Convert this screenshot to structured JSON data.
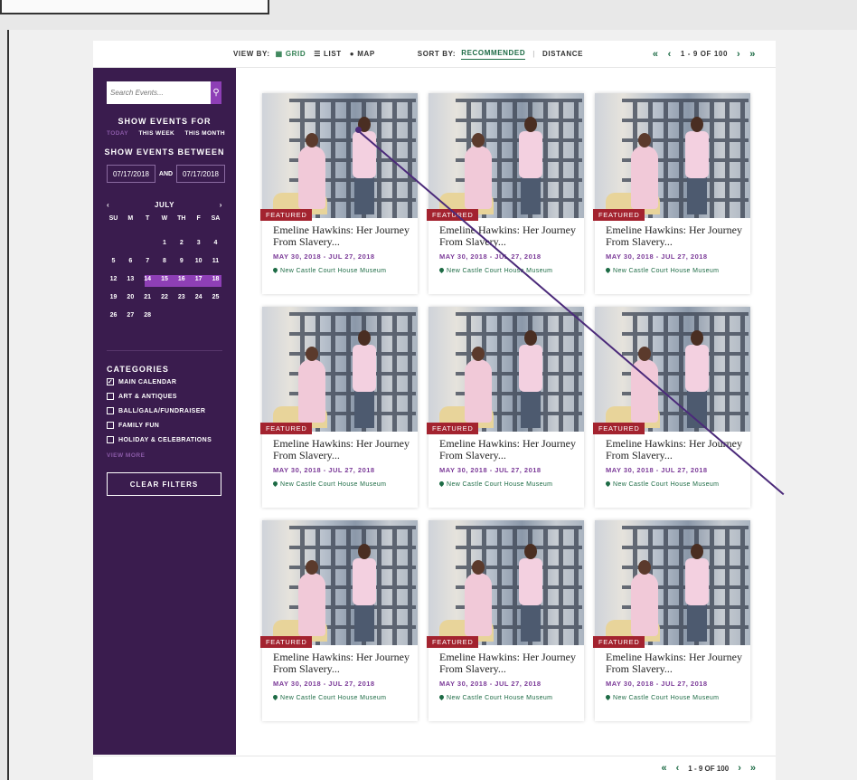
{
  "toolbar": {
    "view_by": "VIEW BY:",
    "view_options": [
      {
        "label": "GRID",
        "icon": "grid-icon"
      },
      {
        "label": "LIST",
        "icon": "list-icon"
      },
      {
        "label": "MAP",
        "icon": "map-pin-icon"
      }
    ],
    "sort_by": "SORT BY:",
    "sort_options": [
      "RECOMMENDED",
      "DISTANCE"
    ],
    "sort_sep": "|",
    "pager_text": "1 - 9 OF 100"
  },
  "sidebar": {
    "search_placeholder": "Search Events...",
    "show_events_for": "SHOW EVENTS FOR",
    "range_tabs": [
      "TODAY",
      "THIS WEEK",
      "THIS MONTH"
    ],
    "show_events_between": "SHOW EVENTS BETWEEN",
    "date_from": "07/17/2018",
    "date_and": "AND",
    "date_to": "07/17/2018",
    "month": "JULY",
    "weekdays": [
      "SU",
      "M",
      "T",
      "W",
      "TH",
      "F",
      "SA"
    ],
    "weeks": [
      [
        "",
        "",
        "",
        "1",
        "2",
        "3",
        "4"
      ],
      [
        "5",
        "6",
        "7",
        "8",
        "9",
        "10",
        "11"
      ],
      [
        "12",
        "13",
        "14",
        "15",
        "16",
        "17",
        "18"
      ],
      [
        "19",
        "20",
        "21",
        "22",
        "23",
        "24",
        "25"
      ],
      [
        "26",
        "27",
        "28",
        "",
        "",
        "",
        ""
      ]
    ],
    "categories_title": "CATEGORIES",
    "categories": [
      {
        "label": "MAIN CALENDAR",
        "checked": true
      },
      {
        "label": "ART & ANTIQUES",
        "checked": false
      },
      {
        "label": "BALL/GALA/FUNDRAISER",
        "checked": false
      },
      {
        "label": "FAMILY FUN",
        "checked": false
      },
      {
        "label": "HOLIDAY & CELEBRATIONS",
        "checked": false
      }
    ],
    "view_more": "VIEW MORE",
    "clear_filters": "CLEAR FILTERS"
  },
  "events": [
    {
      "badge": "FEATURED",
      "title": "Emeline Hawkins: Her Journey From Slavery...",
      "date": "MAY 30, 2018 - JUL 27, 2018",
      "location": "New Castle Court House Museum"
    },
    {
      "badge": "FEATURED",
      "title": "Emeline Hawkins: Her Journey From Slavery...",
      "date": "MAY 30, 2018 - JUL 27, 2018",
      "location": "New Castle Court House Museum"
    },
    {
      "badge": "FEATURED",
      "title": "Emeline Hawkins: Her Journey From Slavery...",
      "date": "MAY 30, 2018 - JUL 27, 2018",
      "location": "New Castle Court House Museum"
    },
    {
      "badge": "FEATURED",
      "title": "Emeline Hawkins: Her Journey From Slavery...",
      "date": "MAY 30, 2018 - JUL 27, 2018",
      "location": "New Castle Court House Museum"
    },
    {
      "badge": "FEATURED",
      "title": "Emeline Hawkins: Her Journey From Slavery...",
      "date": "MAY 30, 2018 - JUL 27, 2018",
      "location": "New Castle Court House Museum"
    },
    {
      "badge": "FEATURED",
      "title": "Emeline Hawkins: Her Journey From Slavery...",
      "date": "MAY 30, 2018 - JUL 27, 2018",
      "location": "New Castle Court House Museum"
    },
    {
      "badge": "FEATURED",
      "title": "Emeline Hawkins: Her Journey From Slavery...",
      "date": "MAY 30, 2018 - JUL 27, 2018",
      "location": "New Castle Court House Museum"
    },
    {
      "badge": "FEATURED",
      "title": "Emeline Hawkins: Her Journey From Slavery...",
      "date": "MAY 30, 2018 - JUL 27, 2018",
      "location": "New Castle Court House Museum"
    },
    {
      "badge": "FEATURED",
      "title": "Emeline Hawkins: Her Journey From Slavery...",
      "date": "MAY 30, 2018 - JUL 27, 2018",
      "location": "New Castle Court House Museum"
    }
  ],
  "bottom_pager_text": "1 - 9 OF 100",
  "colors": {
    "sidebar": "#3a1c4e",
    "accent_purple": "#8e3fb6",
    "accent_green": "#1d6b45",
    "badge_red": "#a3232f"
  }
}
